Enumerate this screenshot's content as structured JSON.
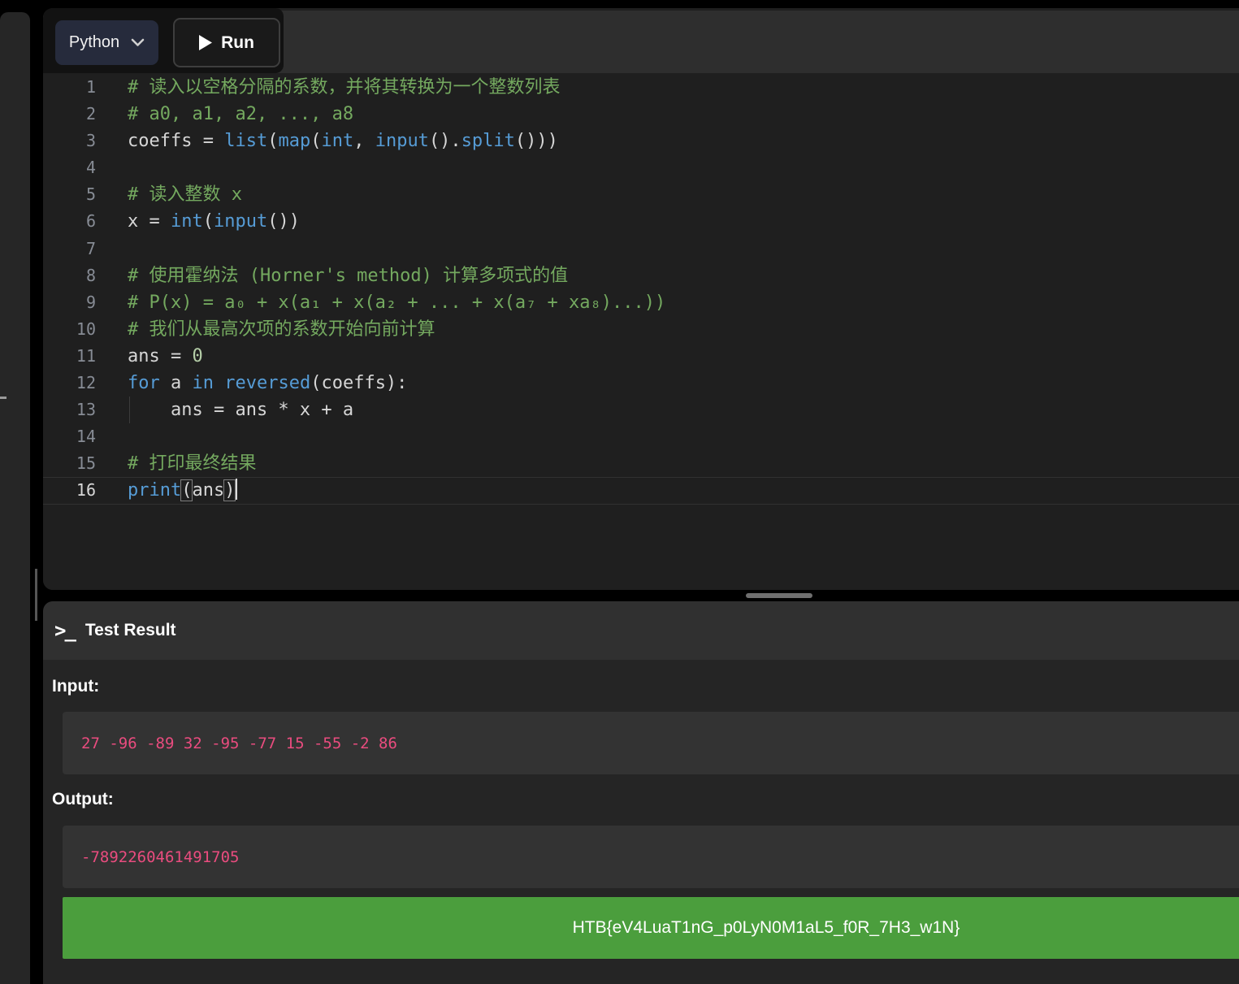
{
  "toolbar": {
    "language": "Python",
    "run_label": "Run"
  },
  "editor": {
    "lines": [
      {
        "num": "1",
        "segments": [
          [
            "comment",
            "# 读入以空格分隔的系数，并将其转换为一个整数列表"
          ]
        ]
      },
      {
        "num": "2",
        "segments": [
          [
            "comment",
            "# a0, a1, a2, ..., a8"
          ]
        ]
      },
      {
        "num": "3",
        "segments": [
          [
            "plain",
            "coeffs = "
          ],
          [
            "func",
            "list"
          ],
          [
            "plain",
            "("
          ],
          [
            "func",
            "map"
          ],
          [
            "plain",
            "("
          ],
          [
            "func",
            "int"
          ],
          [
            "plain",
            ", "
          ],
          [
            "func",
            "input"
          ],
          [
            "plain",
            "()."
          ],
          [
            "func",
            "split"
          ],
          [
            "plain",
            "()))"
          ]
        ]
      },
      {
        "num": "4",
        "segments": []
      },
      {
        "num": "5",
        "segments": [
          [
            "comment",
            "# 读入整数 x"
          ]
        ]
      },
      {
        "num": "6",
        "segments": [
          [
            "plain",
            "x = "
          ],
          [
            "func",
            "int"
          ],
          [
            "plain",
            "("
          ],
          [
            "func",
            "input"
          ],
          [
            "plain",
            "())"
          ]
        ]
      },
      {
        "num": "7",
        "segments": []
      },
      {
        "num": "8",
        "segments": [
          [
            "comment",
            "# 使用霍纳法 (Horner's method) 计算多项式的值"
          ]
        ]
      },
      {
        "num": "9",
        "segments": [
          [
            "comment",
            "# P(x) = a₀ + x(a₁ + x(a₂ + ... + x(a₇ + xa₈)...))"
          ]
        ]
      },
      {
        "num": "10",
        "segments": [
          [
            "comment",
            "# 我们从最高次项的系数开始向前计算"
          ]
        ]
      },
      {
        "num": "11",
        "segments": [
          [
            "plain",
            "ans = "
          ],
          [
            "num",
            "0"
          ]
        ]
      },
      {
        "num": "12",
        "segments": [
          [
            "kw",
            "for"
          ],
          [
            "plain",
            " a "
          ],
          [
            "kw",
            "in"
          ],
          [
            "plain",
            " "
          ],
          [
            "func",
            "reversed"
          ],
          [
            "plain",
            "(coeffs):"
          ]
        ]
      },
      {
        "num": "13",
        "segments": [
          [
            "plain",
            "    ans = ans * x + a"
          ]
        ],
        "indent_guide": true
      },
      {
        "num": "14",
        "segments": []
      },
      {
        "num": "15",
        "segments": [
          [
            "comment",
            "# 打印最终结果"
          ]
        ]
      },
      {
        "num": "16",
        "segments": [
          [
            "func",
            "print"
          ],
          [
            "bracket",
            "("
          ],
          [
            "plain",
            "ans"
          ],
          [
            "bracket",
            ")"
          ]
        ],
        "active": true,
        "caret": true
      }
    ]
  },
  "test_result": {
    "title": "Test Result",
    "input_label": "Input:",
    "input_value": "27 -96 -89 32 -95 -77 15 -55 -2 86",
    "output_label": "Output:",
    "output_value": "-7892260461491705",
    "flag": "HTB{eV4LuaT1nG_p0LyN0M1aL5_f0R_7H3_w1N}"
  },
  "colors": {
    "comment_green": "#74a95f",
    "keyword_blue": "#569cd6",
    "number_green": "#b5cea8",
    "io_pink": "#ea4c7f",
    "success_green": "#4b9e3d",
    "lang_button_bg": "#262b3c"
  }
}
